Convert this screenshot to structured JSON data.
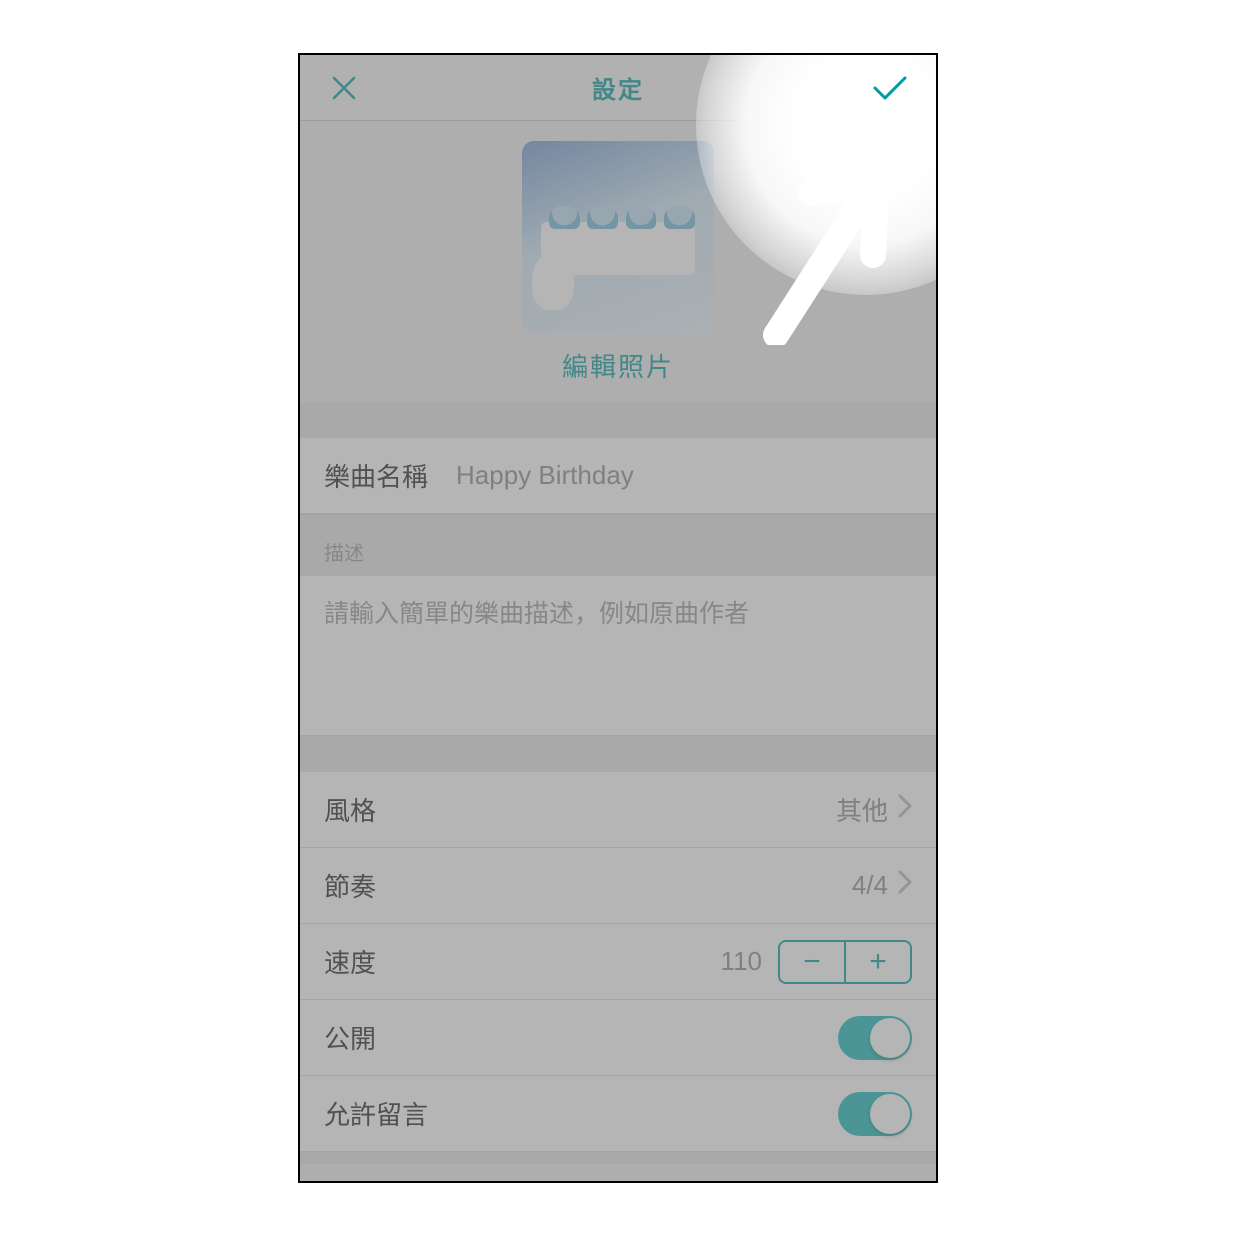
{
  "colors": {
    "accent": "#009b9f"
  },
  "nav": {
    "title": "設定"
  },
  "photo": {
    "edit_label": "編輯照片"
  },
  "song_name": {
    "label": "樂曲名稱",
    "value": "Happy Birthday"
  },
  "description": {
    "header": "描述",
    "placeholder": "請輸入簡單的樂曲描述，例如原曲作者"
  },
  "style": {
    "label": "風格",
    "value": "其他"
  },
  "rhythm": {
    "label": "節奏",
    "value": "4/4"
  },
  "tempo": {
    "label": "速度",
    "value": "110",
    "minus": "−",
    "plus": "+"
  },
  "public": {
    "label": "公開",
    "on": true
  },
  "comments": {
    "label": "允許留言",
    "on": true
  }
}
